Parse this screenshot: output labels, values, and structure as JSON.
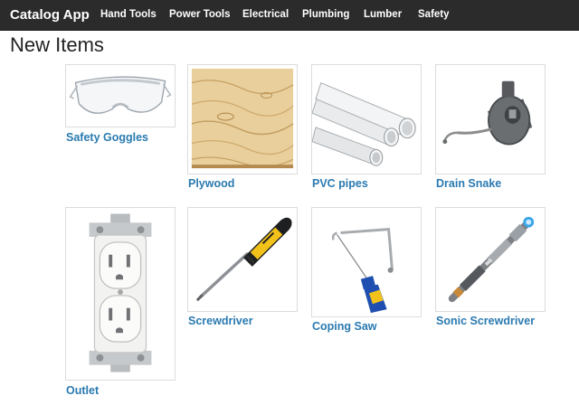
{
  "navbar": {
    "brand": "Catalog App",
    "links": [
      "Hand Tools",
      "Power Tools",
      "Electrical",
      "Plumbing",
      "Lumber",
      "Safety"
    ]
  },
  "page": {
    "title": "New Items"
  },
  "items": [
    {
      "name": "Safety Goggles",
      "icon": "safety-goggles-icon"
    },
    {
      "name": "Plywood",
      "icon": "plywood-icon"
    },
    {
      "name": "PVC pipes",
      "icon": "pvc-pipes-icon"
    },
    {
      "name": "Drain Snake",
      "icon": "drain-snake-icon"
    },
    {
      "name": "Outlet",
      "icon": "outlet-icon"
    },
    {
      "name": "Screwdriver",
      "icon": "screwdriver-icon"
    },
    {
      "name": "Coping Saw",
      "icon": "coping-saw-icon"
    },
    {
      "name": "Sonic Screwdriver",
      "icon": "sonic-screwdriver-icon"
    }
  ],
  "colors": {
    "navbar": "#2b2b2b",
    "link": "#2a7ab0"
  }
}
